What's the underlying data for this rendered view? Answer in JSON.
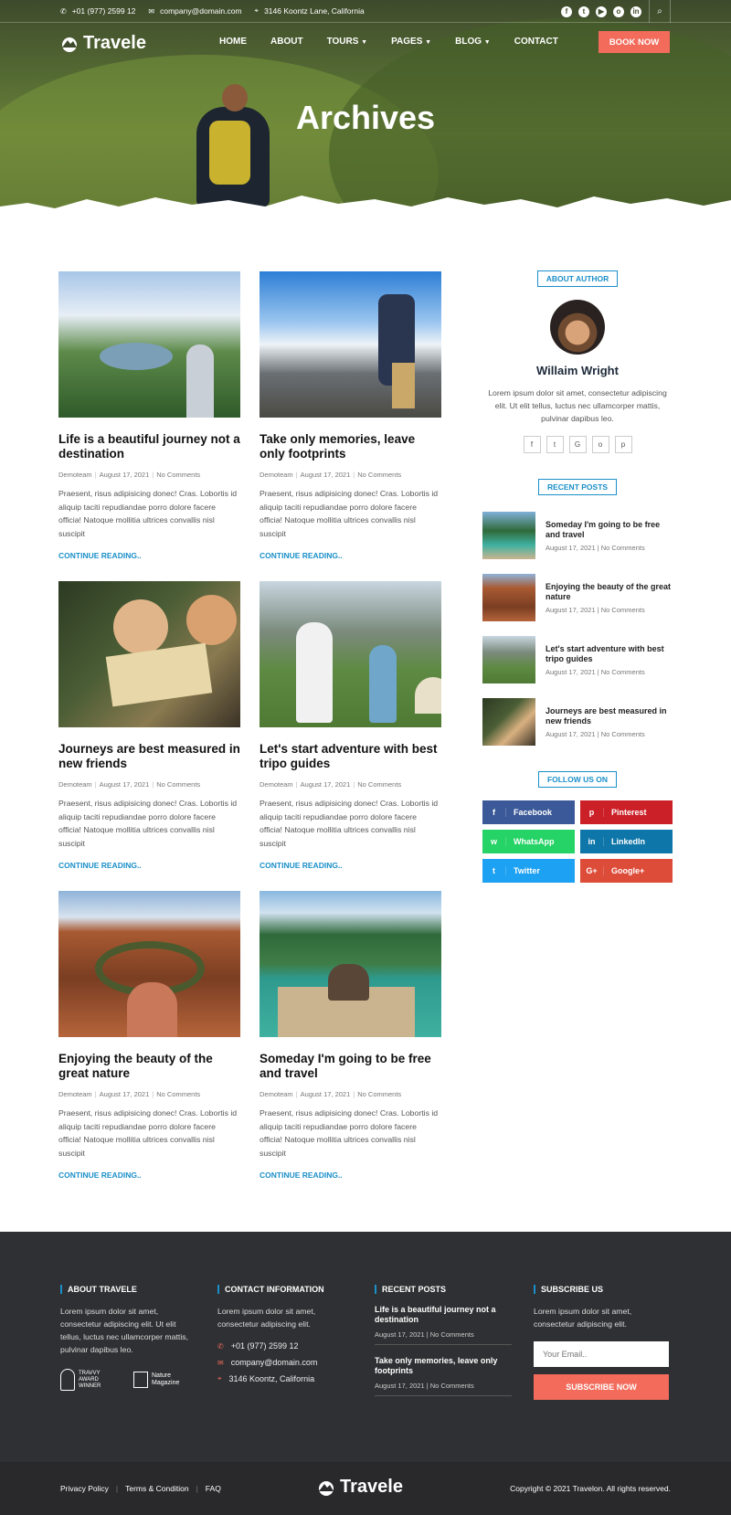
{
  "brand": "Travele",
  "topbar": {
    "phone": "+01 (977) 2599 12",
    "email": "company@domain.com",
    "address": "3146 Koontz Lane, California",
    "social": [
      "facebook-icon",
      "twitter-icon",
      "youtube-icon",
      "instagram-icon",
      "linkedin-icon"
    ]
  },
  "nav": {
    "items": [
      "HOME",
      "ABOUT",
      "TOURS",
      "PAGES",
      "BLOG",
      "CONTACT"
    ],
    "dropdowns": [
      false,
      false,
      true,
      true,
      true,
      false
    ],
    "cta": "BOOK NOW"
  },
  "page_title": "Archives",
  "posts": [
    {
      "title": "Life is a beautiful journey not a destination",
      "author": "Demoteam",
      "date": "August 17, 2021",
      "comments": "No Comments",
      "excerpt": "Praesent, risus adipisicing donec! Cras. Lobortis id aliquip taciti repudiandae porro dolore facere officia! Natoque mollitia ultrices convallis nisl suscipit",
      "more": "CONTINUE READING.."
    },
    {
      "title": "Take only memories, leave only footprints",
      "author": "Demoteam",
      "date": "August 17, 2021",
      "comments": "No Comments",
      "excerpt": "Praesent, risus adipisicing donec! Cras. Lobortis id aliquip taciti repudiandae porro dolore facere officia! Natoque mollitia ultrices convallis nisl suscipit",
      "more": "CONTINUE READING.."
    },
    {
      "title": "Journeys are best measured in new friends",
      "author": "Demoteam",
      "date": "August 17, 2021",
      "comments": "No Comments",
      "excerpt": "Praesent, risus adipisicing donec! Cras. Lobortis id aliquip taciti repudiandae porro dolore facere officia! Natoque mollitia ultrices convallis nisl suscipit",
      "more": "CONTINUE READING.."
    },
    {
      "title": "Let's start adventure with best tripo guides",
      "author": "Demoteam",
      "date": "August 17, 2021",
      "comments": "No Comments",
      "excerpt": "Praesent, risus adipisicing donec! Cras. Lobortis id aliquip taciti repudiandae porro dolore facere officia! Natoque mollitia ultrices convallis nisl suscipit",
      "more": "CONTINUE READING.."
    },
    {
      "title": "Enjoying the beauty of the great nature",
      "author": "Demoteam",
      "date": "August 17, 2021",
      "comments": "No Comments",
      "excerpt": "Praesent, risus adipisicing donec! Cras. Lobortis id aliquip taciti repudiandae porro dolore facere officia! Natoque mollitia ultrices convallis nisl suscipit",
      "more": "CONTINUE READING.."
    },
    {
      "title": "Someday I'm going to be free and travel",
      "author": "Demoteam",
      "date": "August 17, 2021",
      "comments": "No Comments",
      "excerpt": "Praesent, risus adipisicing donec! Cras. Lobortis id aliquip taciti repudiandae porro dolore facere officia! Natoque mollitia ultrices convallis nisl suscipit",
      "more": "CONTINUE READING.."
    }
  ],
  "sidebar": {
    "about_heading": "ABOUT AUTHOR",
    "author_name": "Willaim Wright",
    "author_bio": "Lorem ipsum dolor sit amet, consectetur adipiscing elit. Ut elit tellus, luctus nec ullamcorper mattis, pulvinar dapibus leo.",
    "author_social": [
      "f",
      "t",
      "G",
      "o",
      "p"
    ],
    "recent_heading": "RECENT POSTS",
    "recent": [
      {
        "title": "Someday I'm going to be free and travel",
        "date": "August 17, 2021",
        "comments": "No Comments"
      },
      {
        "title": "Enjoying the beauty of the great nature",
        "date": "August 17, 2021",
        "comments": "No Comments"
      },
      {
        "title": "Let's start adventure with best tripo guides",
        "date": "August 17, 2021",
        "comments": "No Comments"
      },
      {
        "title": "Journeys are best measured in new friends",
        "date": "August 17, 2021",
        "comments": "No Comments"
      }
    ],
    "follow_heading": "FOLLOW US ON",
    "follow": [
      {
        "label": "Facebook",
        "color": "#3b5998",
        "icon": "f"
      },
      {
        "label": "Pinterest",
        "color": "#cb2027",
        "icon": "p"
      },
      {
        "label": "WhatsApp",
        "color": "#25d366",
        "icon": "w"
      },
      {
        "label": "LinkedIn",
        "color": "#0e76a8",
        "icon": "in"
      },
      {
        "label": "Twitter",
        "color": "#1da1f2",
        "icon": "t"
      },
      {
        "label": "Google+",
        "color": "#dd4b39",
        "icon": "G+"
      }
    ]
  },
  "footer": {
    "about_heading": "ABOUT TRAVELE",
    "about_text": "Lorem ipsum dolor sit amet, consectetur adipiscing elit. Ut elit tellus, luctus nec ullamcorper mattis, pulvinar dapibus leo.",
    "badge1": "TRAVVY AWARD WINNER",
    "badge2": "Nature Magazine",
    "contact_heading": "CONTACT INFORMATION",
    "contact_text": "Lorem ipsum dolor sit amet, consectetur adipiscing elit.",
    "phone": "+01 (977) 2599 12",
    "email": "company@domain.com",
    "address": "3146 Koontz, California",
    "recent_heading": "RECENT POSTS",
    "recent": [
      {
        "title": "Life is a beautiful journey not a destination",
        "date": "August 17, 2021",
        "comments": "No Comments"
      },
      {
        "title": "Take only memories, leave only footprints",
        "date": "August 17, 2021",
        "comments": "No Comments"
      }
    ],
    "subscribe_heading": "SUBSCRIBE US",
    "subscribe_text": "Lorem ipsum dolor sit amet, consectetur adipiscing elit.",
    "email_placeholder": "Your Email..",
    "subscribe_btn": "SUBSCRIBE NOW"
  },
  "bottom": {
    "links": [
      "Privacy Policy",
      "Terms & Condition",
      "FAQ"
    ],
    "copyright": "Copyright © 2021 Travelon. All rights reserved."
  }
}
